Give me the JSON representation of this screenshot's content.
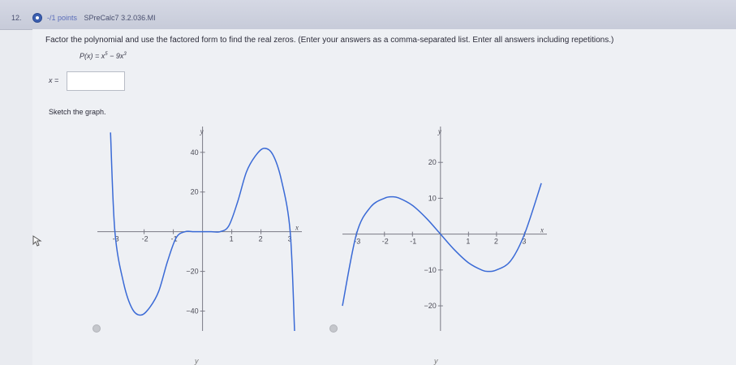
{
  "header": {
    "question_number": "12.",
    "points_label": "-/1 points",
    "assignment_id": "SPreCalc7 3.2.036.MI"
  },
  "question": {
    "instructions": "Factor the polynomial and use the factored form to find the real zeros. (Enter your answers as a comma-separated list. Enter all answers including repetitions.)",
    "formula_lhs": "P(x) = x",
    "formula_exp1": "5",
    "formula_mid": " − 9x",
    "formula_exp2": "3",
    "answer_label": "x =",
    "answer_value": ""
  },
  "sketch": {
    "label": "Sketch the graph."
  },
  "bottom_labels": [
    "y",
    "y"
  ],
  "chart_data": [
    {
      "type": "line",
      "option": "A",
      "x_axis_label": "x",
      "y_axis_label": "y",
      "xlim": [
        -3.6,
        3.4
      ],
      "ylim": [
        -50,
        53
      ],
      "x_ticks": [
        -3,
        -2,
        -1,
        1,
        2,
        3
      ],
      "x_tick_labels": [
        "-3",
        "-2",
        "-1",
        "1",
        "2",
        "3"
      ],
      "y_ticks": [
        40,
        20,
        -20,
        -40
      ],
      "y_tick_labels": [
        "40",
        "20",
        "−20",
        "−40"
      ],
      "series": [
        {
          "x": [
            -3.15,
            -3.0,
            -2.7,
            -2.4,
            -2.1,
            -1.8,
            -1.5,
            -1.2,
            -0.9,
            -0.6,
            -0.3,
            0,
            0.3,
            0.6,
            0.9,
            1.2,
            1.5,
            1.8,
            2.1,
            2.4,
            2.7,
            3.0,
            3.15
          ],
          "y": [
            50,
            0,
            -26,
            -39,
            -42,
            -38,
            -30,
            -15,
            -3,
            0,
            0,
            0,
            0,
            0,
            3,
            15,
            30,
            38,
            42,
            39,
            26,
            0,
            -50
          ]
        }
      ]
    },
    {
      "type": "line",
      "option": "B",
      "x_axis_label": "x",
      "y_axis_label": "y",
      "xlim": [
        -3.5,
        3.8
      ],
      "ylim": [
        -27,
        30
      ],
      "x_ticks": [
        -3,
        -2,
        -1,
        1,
        2,
        3
      ],
      "x_tick_labels": [
        "-3",
        "-2",
        "-1",
        "1",
        "2",
        "3"
      ],
      "y_ticks": [
        20,
        10,
        -10,
        -20
      ],
      "y_tick_labels": [
        "20",
        "10",
        "−10",
        "−20"
      ],
      "series": [
        {
          "x": [
            -3.5,
            -3.0,
            -2.5,
            -2.0,
            -1.73,
            -1.5,
            -1.0,
            -0.5,
            0,
            0.5,
            1.0,
            1.5,
            1.73,
            2.0,
            2.5,
            3.0,
            3.6
          ],
          "y": [
            -20,
            0,
            7.5,
            10,
            10.4,
            10.1,
            8,
            4.4,
            0,
            -4.4,
            -8,
            -10.1,
            -10.4,
            -10,
            -7.5,
            0,
            14.2
          ]
        }
      ]
    }
  ]
}
